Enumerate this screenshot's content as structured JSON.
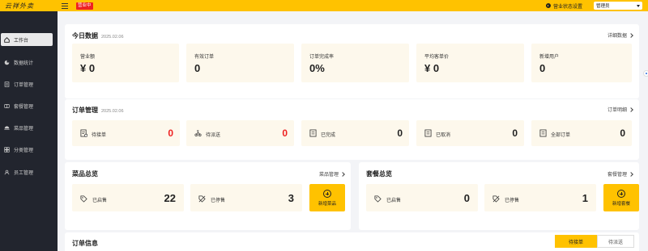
{
  "app": {
    "logo": "云祥外卖",
    "status_badge": "营业中"
  },
  "header": {
    "status_setting": "营业状态设置",
    "admin": "管理员"
  },
  "sidebar": {
    "items": [
      {
        "label": "工作台",
        "icon": "home-icon",
        "active": true
      },
      {
        "label": "数据统计",
        "icon": "chart-icon",
        "active": false
      },
      {
        "label": "订单管理",
        "icon": "order-icon",
        "active": false
      },
      {
        "label": "套餐管理",
        "icon": "combo-icon",
        "active": false
      },
      {
        "label": "菜品管理",
        "icon": "dish-icon",
        "active": false
      },
      {
        "label": "分类管理",
        "icon": "category-icon",
        "active": false
      },
      {
        "label": "员工管理",
        "icon": "employee-icon",
        "active": false
      }
    ]
  },
  "today": {
    "title": "今日数据",
    "date": "2025.02.06",
    "link": "详细数据",
    "stats": [
      {
        "label": "营业额",
        "value": "¥ 0"
      },
      {
        "label": "有效订单",
        "value": "0"
      },
      {
        "label": "订单完成率",
        "value": "0%"
      },
      {
        "label": "平均客单价",
        "value": "¥ 0"
      },
      {
        "label": "新增用户",
        "value": "0"
      }
    ]
  },
  "orders": {
    "title": "订单管理",
    "date": "2025.02.06",
    "link": "订单明细",
    "items": [
      {
        "label": "待接单",
        "value": "0",
        "icon": "order-pending-icon",
        "highlight": true
      },
      {
        "label": "待派送",
        "value": "0",
        "icon": "delivery-icon",
        "highlight": true
      },
      {
        "label": "已完成",
        "value": "0",
        "icon": "order-complete-icon",
        "highlight": false
      },
      {
        "label": "已取消",
        "value": "0",
        "icon": "order-cancel-icon",
        "highlight": false
      },
      {
        "label": "全部订单",
        "value": "0",
        "icon": "order-all-icon",
        "highlight": false
      }
    ]
  },
  "dish_overview": {
    "title": "菜品总览",
    "link": "菜品管理",
    "items": [
      {
        "label": "已启售",
        "value": "22",
        "icon": "on-sale-icon"
      },
      {
        "label": "已停售",
        "value": "3",
        "icon": "off-sale-icon"
      }
    ],
    "add_label": "新增菜品"
  },
  "combo_overview": {
    "title": "套餐总览",
    "link": "套餐管理",
    "items": [
      {
        "label": "已启售",
        "value": "0",
        "icon": "on-sale-icon"
      },
      {
        "label": "已停售",
        "value": "1",
        "icon": "off-sale-icon"
      }
    ],
    "add_label": "新增套餐"
  },
  "order_info": {
    "title": "订单信息",
    "tabs": [
      {
        "label": "待接单",
        "active": true
      },
      {
        "label": "待派送",
        "active": false
      }
    ]
  },
  "colors": {
    "accent": "#ffc200",
    "sidebar": "#22252e",
    "alert": "#e22222"
  }
}
